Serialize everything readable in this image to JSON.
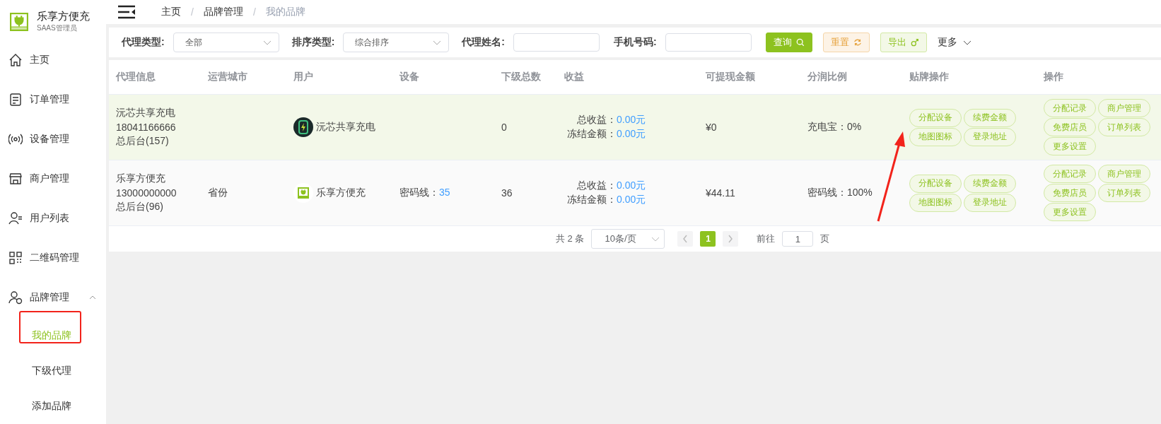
{
  "brand": {
    "name": "乐享方便充",
    "subtitle": "SAAS管理员"
  },
  "sidebar": {
    "items": [
      {
        "label": "主页"
      },
      {
        "label": "订单管理"
      },
      {
        "label": "设备管理"
      },
      {
        "label": "商户管理"
      },
      {
        "label": "用户列表"
      },
      {
        "label": "二维码管理"
      },
      {
        "label": "品牌管理",
        "expanded": true,
        "children": [
          {
            "label": "我的品牌",
            "selected": true
          },
          {
            "label": "下级代理",
            "selected": false
          },
          {
            "label": "添加品牌",
            "selected": false
          }
        ]
      }
    ]
  },
  "breadcrumb": [
    {
      "label": "主页",
      "current": false
    },
    {
      "separator": "/",
      "label": "品牌管理",
      "current": false
    },
    {
      "separator": "/",
      "label": "我的品牌",
      "current": true
    }
  ],
  "filters": [
    {
      "kind": "select",
      "label": "代理类型:",
      "value": "全部"
    },
    {
      "kind": "select",
      "label": "排序类型:",
      "value": "综合排序"
    },
    {
      "kind": "input",
      "label": "代理姓名:"
    },
    {
      "kind": "input",
      "label": "手机号码:"
    }
  ],
  "filter_buttons": [
    {
      "kind": "primary",
      "label": "查询"
    },
    {
      "kind": "warning",
      "label": "重置"
    },
    {
      "kind": "success",
      "label": "导出"
    }
  ],
  "more": {
    "label": "更多"
  },
  "table": {
    "columns": [
      "代理信息",
      "运营城市",
      "用户",
      "设备",
      "下级总数",
      "收益",
      "可提现金额",
      "分润比例",
      "贴牌操作",
      "操作"
    ],
    "rows": [
      {
        "selected": true,
        "agent": [
          "沅芯共享充电",
          "18041166666",
          "总后台(157)"
        ],
        "user": {
          "name": "沅芯共享充电"
        },
        "sub_count": "0",
        "income": [
          {
            "label": "总收益：",
            "value": "0.00元"
          },
          {
            "label": "冻结金额：",
            "value": "0.00元"
          }
        ],
        "withdrawable": "¥0",
        "ratio": "充电宝：0%",
        "brand_actions": [
          "分配设备",
          "续费金额",
          "地图图标",
          "登录地址"
        ],
        "actions": [
          "分配记录",
          "商户管理",
          "免费店员",
          "订单列表",
          "更多设置"
        ]
      },
      {
        "selected": false,
        "agent": [
          "乐享方便充",
          "13000000000",
          "总后台(96)"
        ],
        "city": "省份",
        "user": {
          "name": "乐享方便充"
        },
        "device": {
          "label": "密码线：",
          "value": "35"
        },
        "sub_count": "36",
        "income": [
          {
            "label": "总收益：",
            "value": "0.00元"
          },
          {
            "label": "冻结金额：",
            "value": "0.00元"
          }
        ],
        "withdrawable": "¥44.11",
        "ratio": "密码线：100%",
        "brand_actions": [
          "分配设备",
          "续费金额",
          "地图图标",
          "登录地址"
        ],
        "actions": [
          "分配记录",
          "商户管理",
          "免费店员",
          "订单列表",
          "更多设置"
        ]
      }
    ]
  },
  "pagination": {
    "total": "共 2 条",
    "page_size": "10条/页",
    "pages": [
      {
        "label": "1",
        "selected": true
      }
    ],
    "goto_label": "前往",
    "goto_value": "1",
    "goto_suffix": "页"
  }
}
